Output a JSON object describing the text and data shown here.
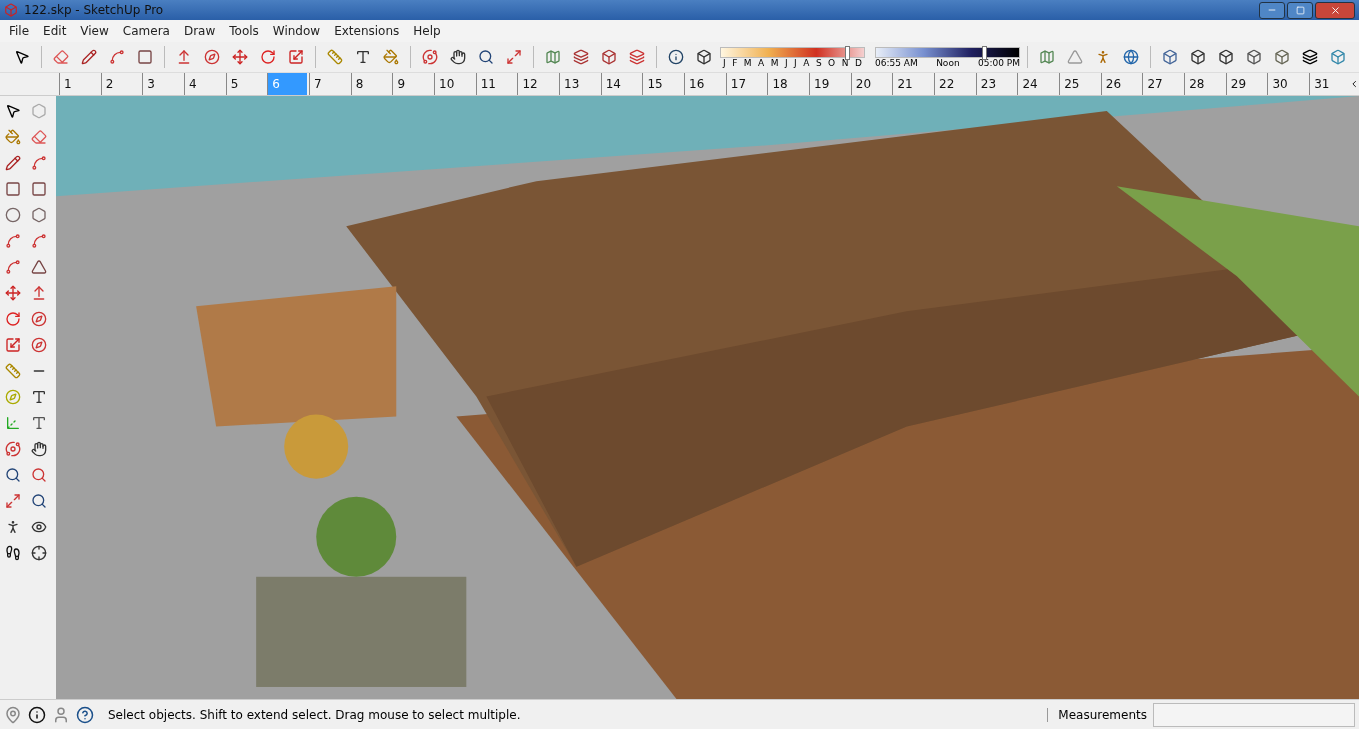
{
  "window": {
    "title": "122.skp - SketchUp Pro"
  },
  "menu": [
    "File",
    "Edit",
    "View",
    "Camera",
    "Draw",
    "Tools",
    "Window",
    "Extensions",
    "Help"
  ],
  "shadow": {
    "months": [
      "J",
      "F",
      "M",
      "A",
      "M",
      "J",
      "J",
      "A",
      "S",
      "O",
      "N",
      "D"
    ],
    "month_slider": {
      "level": 0.87
    },
    "time_start": "06:55 AM",
    "time_mid": "Noon",
    "time_end": "05:00 PM",
    "time_slider": {
      "level": 0.74
    }
  },
  "ruler": [
    {
      "label": "1",
      "selected": false
    },
    {
      "label": "2",
      "selected": false
    },
    {
      "label": "3",
      "selected": false
    },
    {
      "label": "4",
      "selected": false
    },
    {
      "label": "5",
      "selected": false
    },
    {
      "label": "6",
      "selected": true
    },
    {
      "label": "7",
      "selected": false
    },
    {
      "label": "8",
      "selected": false
    },
    {
      "label": "9",
      "selected": false
    },
    {
      "label": "10",
      "selected": false
    },
    {
      "label": "11",
      "selected": false
    },
    {
      "label": "12",
      "selected": false
    },
    {
      "label": "13",
      "selected": false
    },
    {
      "label": "14",
      "selected": false
    },
    {
      "label": "15",
      "selected": false
    },
    {
      "label": "16",
      "selected": false
    },
    {
      "label": "17",
      "selected": false
    },
    {
      "label": "18",
      "selected": false
    },
    {
      "label": "19",
      "selected": false
    },
    {
      "label": "20",
      "selected": false
    },
    {
      "label": "21",
      "selected": false
    },
    {
      "label": "22",
      "selected": false
    },
    {
      "label": "23",
      "selected": false
    },
    {
      "label": "24",
      "selected": false
    },
    {
      "label": "25",
      "selected": false
    },
    {
      "label": "26",
      "selected": false
    },
    {
      "label": "27",
      "selected": false
    },
    {
      "label": "28",
      "selected": false
    },
    {
      "label": "29",
      "selected": false
    },
    {
      "label": "30",
      "selected": false
    },
    {
      "label": "31",
      "selected": false
    }
  ],
  "status_bar": {
    "hint": "Select objects. Shift to extend select. Drag mouse to select multiple.",
    "measurements_label": "Measurements"
  }
}
